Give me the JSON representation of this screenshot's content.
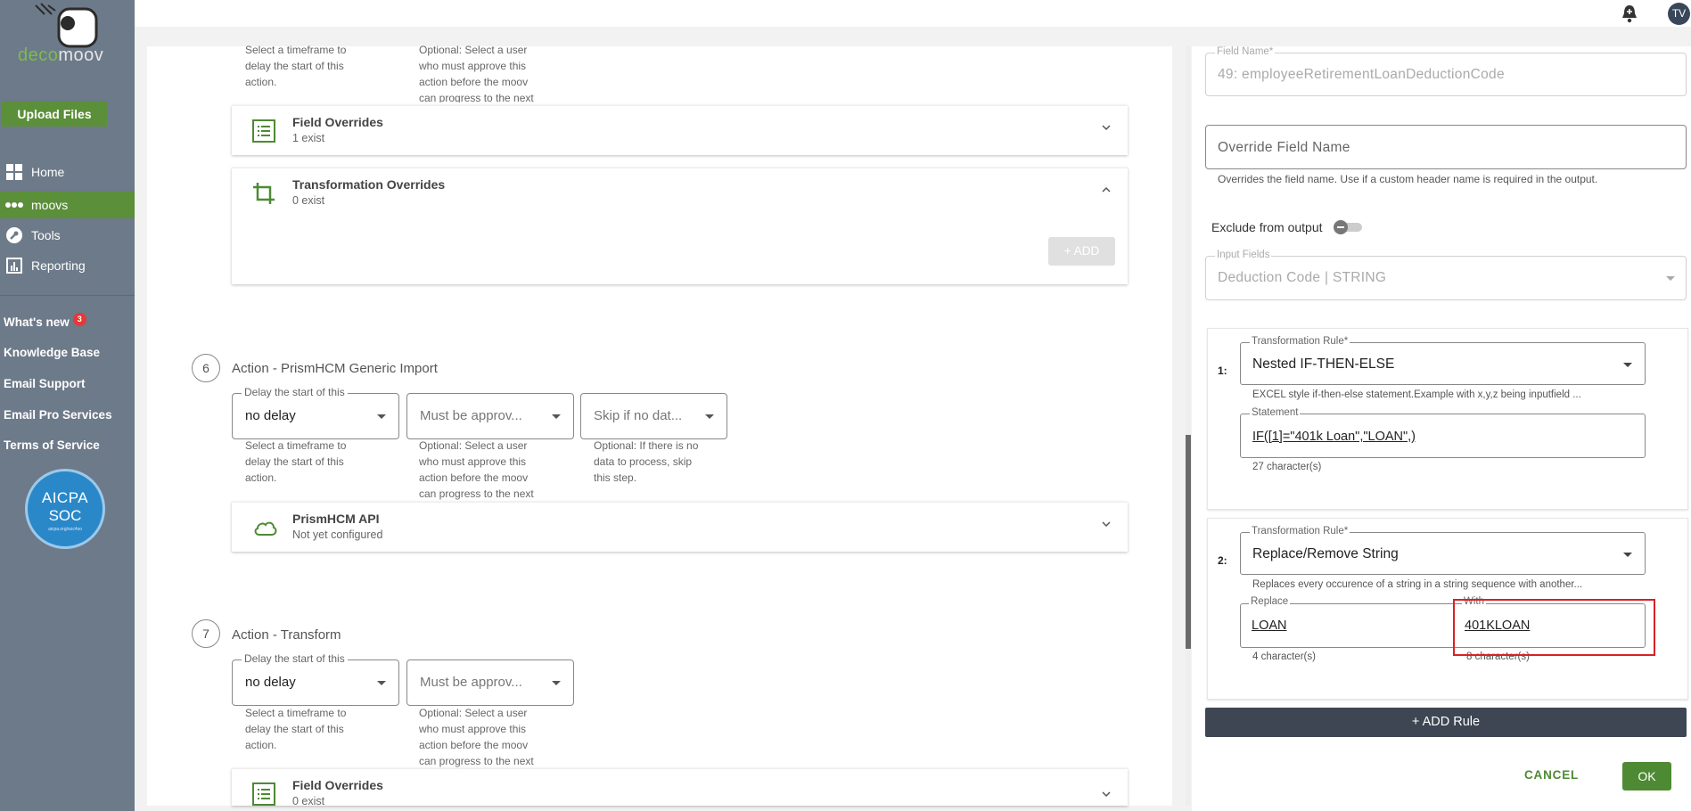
{
  "sidebar": {
    "brand_left": "deco",
    "brand_right": "moov",
    "upload_label": "Upload Files",
    "nav": [
      {
        "label": "Home",
        "icon": "grid-icon"
      },
      {
        "label": "moovs",
        "icon": "dots-icon"
      },
      {
        "label": "Tools",
        "icon": "wrench-icon"
      },
      {
        "label": "Reporting",
        "icon": "chart-icon"
      }
    ],
    "links": {
      "whats_new": "What's new",
      "whats_new_badge": "3",
      "knowledge_base": "Knowledge Base",
      "email_support": "Email Support",
      "email_pro": "Email Pro Services",
      "terms": "Terms of Service"
    },
    "aicpa": {
      "line1": "AICPA",
      "line2": "SOC",
      "line3": "aicpa.org/soc4so"
    }
  },
  "topbar": {
    "avatar": "TV"
  },
  "main": {
    "top_helper_1": "Select a timeframe to delay the start of this action.",
    "top_helper_2": "Optional: Select a user who must approve this action before the moov can progress to the next",
    "field_overrides_1": {
      "title": "Field Overrides",
      "sub": "1 exist"
    },
    "transformation_overrides": {
      "title": "Transformation Overrides",
      "sub": "0 exist",
      "add_label": "+ ADD"
    },
    "step6": {
      "num": "6",
      "title": "Action - PrismHCM Generic Import",
      "delay_label": "Delay the start of this",
      "delay_value": "no delay",
      "approve_value": "Must be approv...",
      "skip_value": "Skip if no dat...",
      "helper_delay": "Select a timeframe to delay the start of this action.",
      "helper_approve": "Optional: Select a user who must approve this action before the moov can progress to the next",
      "helper_skip": "Optional: If there is no data to process, skip this step.",
      "api_title": "PrismHCM API",
      "api_sub": "Not yet configured"
    },
    "step7": {
      "num": "7",
      "title": "Action - Transform",
      "delay_label": "Delay the start of this",
      "delay_value": "no delay",
      "approve_value": "Must be approv...",
      "helper_delay": "Select a timeframe to delay the start of this action.",
      "helper_approve": "Optional: Select a user who must approve this action before the moov can progress to the next",
      "field_overrides_title": "Field Overrides",
      "field_overrides_sub": "0 exist"
    }
  },
  "right": {
    "field_name_label": "Field Name*",
    "field_name_value": "49: employeeRetirementLoanDeductionCode",
    "override_placeholder": "Override Field Name",
    "override_help": "Overrides the field name. Use if a custom header name is required in the output.",
    "exclude_label": "Exclude from output",
    "input_fields_label": "Input Fields",
    "input_fields_value": "Deduction Code | STRING",
    "rule1": {
      "num": "1:",
      "rule_label": "Transformation Rule*",
      "rule_value": "Nested IF-THEN-ELSE",
      "rule_help": "EXCEL style if-then-else statement.Example with x,y,z being inputfield ...",
      "statement_label": "Statement",
      "statement_value": "IF([1]=\"401k Loan\",\"LOAN\",)",
      "count": "27 character(s)"
    },
    "rule2": {
      "num": "2:",
      "rule_label": "Transformation Rule*",
      "rule_value": "Replace/Remove String",
      "rule_help": "Replaces every occurence of a string in a string sequence with another...",
      "replace_label": "Replace",
      "replace_value": "LOAN",
      "replace_count": "4 character(s)",
      "with_label": "With",
      "with_value": "401KLOAN",
      "with_count": "8 character(s)"
    },
    "add_rule": "+ ADD Rule",
    "cancel": "CANCEL",
    "ok": "OK"
  }
}
